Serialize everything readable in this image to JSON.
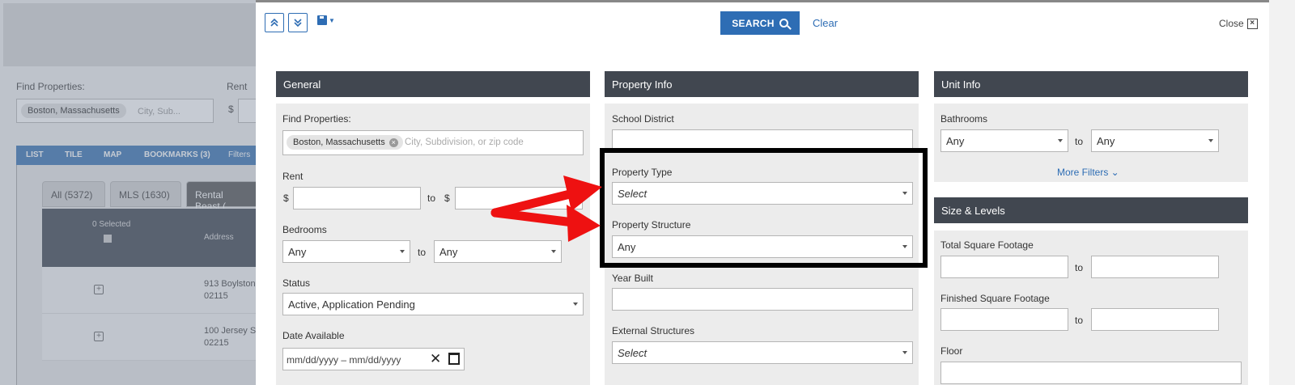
{
  "background": {
    "find_label": "Find Properties:",
    "rent_label": "Rent",
    "chip": "Boston, Massachusetts",
    "placeholder": "City, Sub...",
    "dollar": "$",
    "tabs": [
      "LIST",
      "TILE",
      "MAP",
      "BOOKMARKS (3)",
      "Filters"
    ],
    "subtabs": [
      "All (5372)",
      "MLS (1630)",
      "Rental Beast ("
    ],
    "selected_count": "0 Selected",
    "address_header": "Address",
    "rows": [
      {
        "line1": "913 Boylston",
        "line2": "02115"
      },
      {
        "line1": "100 Jersey S",
        "line2": "02215"
      }
    ]
  },
  "toolbar": {
    "search_label": "SEARCH",
    "clear_label": "Clear",
    "close_label": "Close",
    "close_icon": "×"
  },
  "general": {
    "title": "General",
    "find_label": "Find Properties:",
    "chip": "Boston, Massachusetts",
    "chip_remove": "×",
    "find_placeholder": "City, Subdivision, or zip code",
    "rent_label": "Rent",
    "dollar": "$",
    "to": "to",
    "bedrooms_label": "Bedrooms",
    "bedrooms_min": "Any",
    "bedrooms_max": "Any",
    "status_label": "Status",
    "status_value": "Active, Application Pending",
    "date_label": "Date Available",
    "date_value": "mm/dd/yyyy – mm/dd/yyyy",
    "date_clear": "✕"
  },
  "property_info": {
    "title": "Property Info",
    "school_label": "School District",
    "type_label": "Property Type",
    "type_value": "Select",
    "structure_label": "Property Structure",
    "structure_value": "Any",
    "year_label": "Year Built",
    "external_label": "External Structures",
    "external_value": "Select"
  },
  "unit_info": {
    "title": "Unit Info",
    "bath_label": "Bathrooms",
    "bath_min": "Any",
    "bath_max": "Any",
    "to": "to",
    "more_filters": "More Filters ⌄"
  },
  "size_levels": {
    "title": "Size & Levels",
    "total_label": "Total Square Footage",
    "finished_label": "Finished Square Footage",
    "floor_label": "Floor",
    "to": "to"
  },
  "annotation": {
    "arrow_color": "#ee1111",
    "box_color": "#000000"
  }
}
